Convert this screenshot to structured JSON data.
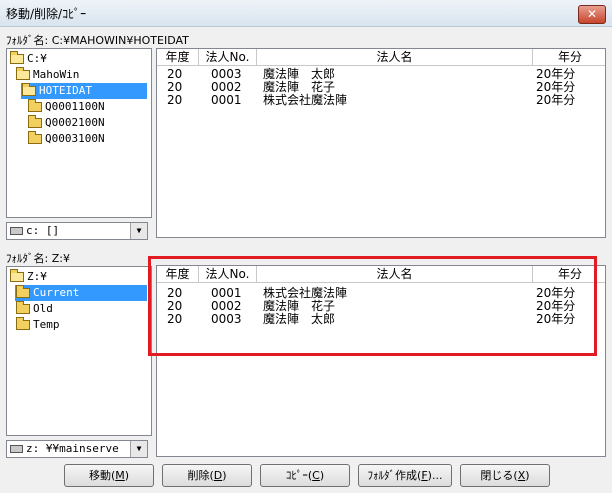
{
  "window": {
    "title": "移動/削除/ｺﾋﾟｰ",
    "close_label": "✕"
  },
  "top": {
    "folder_label": "ﾌｫﾙﾀﾞ名: C:¥MAHOWIN¥HOTEIDAT",
    "tree": [
      "C:¥",
      "MahoWin",
      "HOTEIDAT",
      "Q0001100N",
      "Q0002100N",
      "Q0003100N"
    ],
    "drive": "c: []",
    "columns": [
      "年度",
      "法人No.",
      "法人名",
      "年分"
    ],
    "rows": [
      [
        "20",
        "0003",
        "魔法陣　太郎",
        "20年分"
      ],
      [
        "20",
        "0002",
        "魔法陣　花子",
        "20年分"
      ],
      [
        "20",
        "0001",
        "株式会社魔法陣",
        "20年分"
      ]
    ]
  },
  "bottom": {
    "folder_label": "ﾌｫﾙﾀﾞ名: Z:¥",
    "tree": [
      "Z:¥",
      "Current",
      "Old",
      "Temp"
    ],
    "drive": "z: ¥¥mainserve",
    "columns": [
      "年度",
      "法人No.",
      "法人名",
      "年分"
    ],
    "rows": [
      [
        "20",
        "0001",
        "株式会社魔法陣",
        "20年分"
      ],
      [
        "20",
        "0002",
        "魔法陣　花子",
        "20年分"
      ],
      [
        "20",
        "0003",
        "魔法陣　太郎",
        "20年分"
      ]
    ]
  },
  "buttons": {
    "move": {
      "label": "移動(",
      "key": "M",
      "end": ")"
    },
    "delete": {
      "label": "削除(",
      "key": "D",
      "end": ")"
    },
    "copy": {
      "label": "ｺﾋﾟｰ(",
      "key": "C",
      "end": ")"
    },
    "mkdir": {
      "label": "ﾌｫﾙﾀﾞ作成(",
      "key": "F",
      "end": ")..."
    },
    "close": {
      "label": "閉じる(",
      "key": "X",
      "end": ")"
    }
  },
  "colors": {
    "selection": "#3399ff",
    "highlight": "#e21b23"
  }
}
